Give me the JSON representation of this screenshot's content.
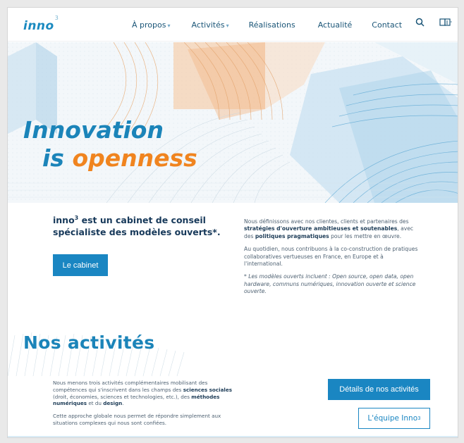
{
  "header": {
    "logo_text": "inno",
    "logo_sup": "3",
    "nav": [
      {
        "label": "À propos",
        "dropdown": true
      },
      {
        "label": "Activités",
        "dropdown": true
      },
      {
        "label": "Réalisations",
        "dropdown": false
      },
      {
        "label": "Actualité",
        "dropdown": false
      },
      {
        "label": "Contact",
        "dropdown": false
      }
    ],
    "search_icon": "search-icon",
    "menu_icon": "book-icon"
  },
  "hero": {
    "title_line1": "Innovation",
    "title_line2_prefix": "is ",
    "title_line2_highlight": "openness"
  },
  "intro": {
    "heading_prefix": "inno",
    "heading_sup": "3",
    "heading_rest": " est un cabinet de conseil spécialiste des modèles ouverts*.",
    "button_label": "Le cabinet",
    "p1_a": "Nous définissons avec nos clientes, clients et partenaires des ",
    "p1_b": "stratégies d'ouverture ambitieuses et soutenables",
    "p1_c": ", avec des ",
    "p1_d": "politiques pragmatiques",
    "p1_e": " pour les mettre en œuvre.",
    "p2": "Au quotidien, nous contribuons à la co-construction de pratiques collaboratives vertueuses en France, en Europe et à l'international.",
    "note": "* Les modèles ouverts incluent : Open source, open data, open hardware, communs numériques, innovation ouverte et science ouverte."
  },
  "activities": {
    "title": "Nos activités",
    "p1_a": "Nous menons trois activités complémentaires mobilisant des compétences qui s'inscrivent dans les champs des ",
    "p1_b": "sciences sociales",
    "p1_c": " (droit, économies, sciences et technologies, etc.), des ",
    "p1_d": "méthodes numériques",
    "p1_e": " et du ",
    "p1_f": "design",
    "p1_g": ".",
    "p2": "Cette approche globale nous permet de répondre simplement aux situations complexes qui nous sont confiées.",
    "details_button": "Détails de nos activités",
    "team_button_prefix": "L'équipe Inno",
    "team_button_sup": "3"
  },
  "colors": {
    "primary": "#1a86c2",
    "accent_orange": "#f0841f",
    "dark_text": "#17395a"
  }
}
